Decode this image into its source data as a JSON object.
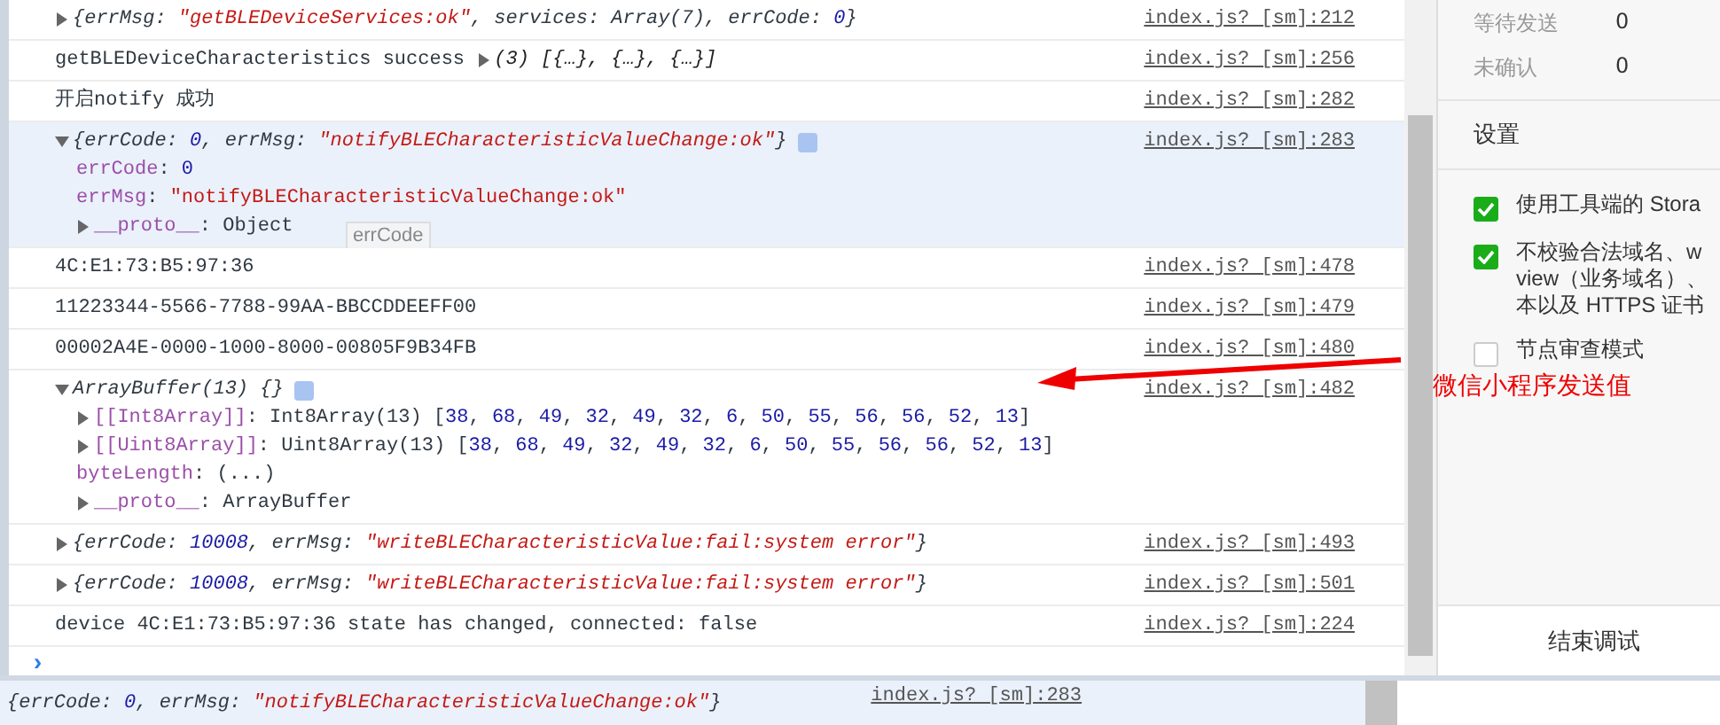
{
  "console": {
    "rows": [
      {
        "selected": false,
        "source": "index.js? [sm]:212",
        "line": {
          "preview": true,
          "tokens": [
            {
              "kind": "toggle",
              "expanded": false
            },
            {
              "kind": "plain",
              "text": "{errMsg: "
            },
            {
              "kind": "str",
              "text": "\"getBLEDeviceServices:ok\""
            },
            {
              "kind": "plain",
              "text": ", services: Array(7), errCode: "
            },
            {
              "kind": "num",
              "text": "0"
            },
            {
              "kind": "plain",
              "text": "}"
            }
          ]
        }
      },
      {
        "selected": false,
        "source": "index.js? [sm]:256",
        "line": {
          "preview": false,
          "tokens": [
            {
              "kind": "plain",
              "text": "getBLEDeviceCharacteristics success "
            },
            {
              "kind": "toggle",
              "expanded": false
            },
            {
              "kind": "italic",
              "text": "(3) [{…}, {…}, {…}]"
            }
          ]
        }
      },
      {
        "selected": false,
        "source": "index.js? [sm]:282",
        "line": {
          "preview": false,
          "tokens": [
            {
              "kind": "plain",
              "text": "开启notify 成功"
            }
          ]
        }
      },
      {
        "selected": true,
        "source": "index.js? [sm]:283",
        "tooltip": "errCode",
        "line": {
          "preview": true,
          "info": true,
          "tokens": [
            {
              "kind": "toggle",
              "expanded": true
            },
            {
              "kind": "plain",
              "text": "{errCode: "
            },
            {
              "kind": "num",
              "text": "0"
            },
            {
              "kind": "plain",
              "text": ", errMsg: "
            },
            {
              "kind": "str",
              "text": "\"notifyBLECharacteristicValueChange:ok\""
            },
            {
              "kind": "plain",
              "text": "}"
            }
          ]
        },
        "children": [
          {
            "tokens": [
              {
                "kind": "prop",
                "text": "errCode"
              },
              {
                "kind": "plain",
                "text": ": "
              },
              {
                "kind": "num",
                "text": "0"
              }
            ]
          },
          {
            "tokens": [
              {
                "kind": "prop",
                "text": "errMsg"
              },
              {
                "kind": "plain",
                "text": ": "
              },
              {
                "kind": "str",
                "text": "\"notifyBLECharacteristicValueChange:ok\""
              }
            ]
          },
          {
            "tokens": [
              {
                "kind": "toggle",
                "expanded": false
              },
              {
                "kind": "prop",
                "text": "__proto__"
              },
              {
                "kind": "plain",
                "text": ": Object"
              }
            ]
          }
        ]
      },
      {
        "selected": false,
        "source": "index.js? [sm]:478",
        "line": {
          "preview": false,
          "tokens": [
            {
              "kind": "plain",
              "text": "4C:E1:73:B5:97:36"
            }
          ]
        }
      },
      {
        "selected": false,
        "source": "index.js? [sm]:479",
        "line": {
          "preview": false,
          "tokens": [
            {
              "kind": "plain",
              "text": "11223344-5566-7788-99AA-BBCCDDEEFF00"
            }
          ]
        }
      },
      {
        "selected": false,
        "source": "index.js? [sm]:480",
        "line": {
          "preview": false,
          "tokens": [
            {
              "kind": "plain",
              "text": "00002A4E-0000-1000-8000-00805F9B34FB"
            }
          ]
        }
      },
      {
        "selected": false,
        "source": "index.js? [sm]:482",
        "line": {
          "preview": true,
          "info": true,
          "tokens": [
            {
              "kind": "toggle",
              "expanded": true
            },
            {
              "kind": "plain",
              "text": "ArrayBuffer(13) {}"
            }
          ]
        },
        "children": [
          {
            "tokens": [
              {
                "kind": "toggle",
                "expanded": false
              },
              {
                "kind": "prop",
                "text": "[[Int8Array]]"
              },
              {
                "kind": "plain",
                "text": ": Int8Array(13) ["
              },
              {
                "kind": "num",
                "text": "38"
              },
              {
                "kind": "plain",
                "text": ", "
              },
              {
                "kind": "num",
                "text": "68"
              },
              {
                "kind": "plain",
                "text": ", "
              },
              {
                "kind": "num",
                "text": "49"
              },
              {
                "kind": "plain",
                "text": ", "
              },
              {
                "kind": "num",
                "text": "32"
              },
              {
                "kind": "plain",
                "text": ", "
              },
              {
                "kind": "num",
                "text": "49"
              },
              {
                "kind": "plain",
                "text": ", "
              },
              {
                "kind": "num",
                "text": "32"
              },
              {
                "kind": "plain",
                "text": ", "
              },
              {
                "kind": "num",
                "text": "6"
              },
              {
                "kind": "plain",
                "text": ", "
              },
              {
                "kind": "num",
                "text": "50"
              },
              {
                "kind": "plain",
                "text": ", "
              },
              {
                "kind": "num",
                "text": "55"
              },
              {
                "kind": "plain",
                "text": ", "
              },
              {
                "kind": "num",
                "text": "56"
              },
              {
                "kind": "plain",
                "text": ", "
              },
              {
                "kind": "num",
                "text": "56"
              },
              {
                "kind": "plain",
                "text": ", "
              },
              {
                "kind": "num",
                "text": "52"
              },
              {
                "kind": "plain",
                "text": ", "
              },
              {
                "kind": "num",
                "text": "13"
              },
              {
                "kind": "plain",
                "text": "]"
              }
            ]
          },
          {
            "tokens": [
              {
                "kind": "toggle",
                "expanded": false
              },
              {
                "kind": "prop",
                "text": "[[Uint8Array]]"
              },
              {
                "kind": "plain",
                "text": ": Uint8Array(13) ["
              },
              {
                "kind": "num",
                "text": "38"
              },
              {
                "kind": "plain",
                "text": ", "
              },
              {
                "kind": "num",
                "text": "68"
              },
              {
                "kind": "plain",
                "text": ", "
              },
              {
                "kind": "num",
                "text": "49"
              },
              {
                "kind": "plain",
                "text": ", "
              },
              {
                "kind": "num",
                "text": "32"
              },
              {
                "kind": "plain",
                "text": ", "
              },
              {
                "kind": "num",
                "text": "49"
              },
              {
                "kind": "plain",
                "text": ", "
              },
              {
                "kind": "num",
                "text": "32"
              },
              {
                "kind": "plain",
                "text": ", "
              },
              {
                "kind": "num",
                "text": "6"
              },
              {
                "kind": "plain",
                "text": ", "
              },
              {
                "kind": "num",
                "text": "50"
              },
              {
                "kind": "plain",
                "text": ", "
              },
              {
                "kind": "num",
                "text": "55"
              },
              {
                "kind": "plain",
                "text": ", "
              },
              {
                "kind": "num",
                "text": "56"
              },
              {
                "kind": "plain",
                "text": ", "
              },
              {
                "kind": "num",
                "text": "56"
              },
              {
                "kind": "plain",
                "text": ", "
              },
              {
                "kind": "num",
                "text": "52"
              },
              {
                "kind": "plain",
                "text": ", "
              },
              {
                "kind": "num",
                "text": "13"
              },
              {
                "kind": "plain",
                "text": "]"
              }
            ]
          },
          {
            "tokens": [
              {
                "kind": "prop",
                "text": "byteLength"
              },
              {
                "kind": "plain",
                "text": ": (...)"
              }
            ]
          },
          {
            "tokens": [
              {
                "kind": "toggle",
                "expanded": false
              },
              {
                "kind": "prop",
                "text": "__proto__"
              },
              {
                "kind": "plain",
                "text": ": ArrayBuffer"
              }
            ]
          }
        ]
      },
      {
        "selected": false,
        "source": "index.js? [sm]:493",
        "line": {
          "preview": true,
          "tokens": [
            {
              "kind": "toggle",
              "expanded": false
            },
            {
              "kind": "plain",
              "text": "{errCode: "
            },
            {
              "kind": "num",
              "text": "10008"
            },
            {
              "kind": "plain",
              "text": ", errMsg: "
            },
            {
              "kind": "str",
              "text": "\"writeBLECharacteristicValue:fail:system error\""
            },
            {
              "kind": "plain",
              "text": "}"
            }
          ]
        }
      },
      {
        "selected": false,
        "source": "index.js? [sm]:501",
        "line": {
          "preview": true,
          "tokens": [
            {
              "kind": "toggle",
              "expanded": false
            },
            {
              "kind": "plain",
              "text": "{errCode: "
            },
            {
              "kind": "num",
              "text": "10008"
            },
            {
              "kind": "plain",
              "text": ", errMsg: "
            },
            {
              "kind": "str",
              "text": "\"writeBLECharacteristicValue:fail:system error\""
            },
            {
              "kind": "plain",
              "text": "}"
            }
          ]
        }
      },
      {
        "selected": false,
        "source": "index.js? [sm]:224",
        "line": {
          "preview": false,
          "tokens": [
            {
              "kind": "plain",
              "text": "device 4C:E1:73:B5:97:36 state has changed, connected: false"
            }
          ]
        }
      }
    ],
    "prompt": "›"
  },
  "side_panel": {
    "stats": [
      {
        "label": "等待发送",
        "value": "0"
      },
      {
        "label": "未确认",
        "value": "0"
      }
    ],
    "settings_title": "设置",
    "settings": [
      {
        "checked": true,
        "lines": [
          "使用工具端的 Stora"
        ]
      },
      {
        "checked": true,
        "lines": [
          "不校验合法域名、w",
          "view（业务域名）、",
          "本以及 HTTPS 证书"
        ]
      },
      {
        "checked": false,
        "lines": [
          "节点审查模式"
        ]
      }
    ],
    "end_button": "结束调试"
  },
  "annotation": {
    "label": "微信小程序发送值"
  },
  "lower_console": {
    "line": {
      "preview": true,
      "tokens": [
        {
          "kind": "plain",
          "text": "{errCode: "
        },
        {
          "kind": "num",
          "text": "0"
        },
        {
          "kind": "plain",
          "text": ", errMsg: "
        },
        {
          "kind": "str",
          "text": "\"notifyBLECharacteristicValueChange:ok\""
        },
        {
          "kind": "plain",
          "text": "}"
        }
      ]
    },
    "source": "index.js? [sm]:283"
  }
}
